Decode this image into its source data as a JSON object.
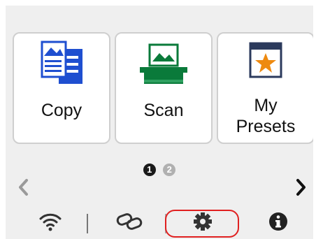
{
  "home": {
    "tiles": [
      {
        "label": "Copy",
        "icon": "copy-icon"
      },
      {
        "label": "Scan",
        "icon": "scan-icon"
      },
      {
        "label": "My\nPresets",
        "icon": "star-preset-icon"
      }
    ],
    "pagination": {
      "current": "1",
      "other": "2"
    }
  },
  "bottom_bar": {
    "icons": [
      "wifi-icon",
      "link-icon",
      "gear-icon",
      "info-icon"
    ],
    "highlighted": "gear-icon"
  },
  "colors": {
    "icon_blue": "#1f4fd0",
    "icon_green": "#0a7a3a",
    "star_orange": "#ee8a10",
    "highlight_red": "#e02020"
  }
}
